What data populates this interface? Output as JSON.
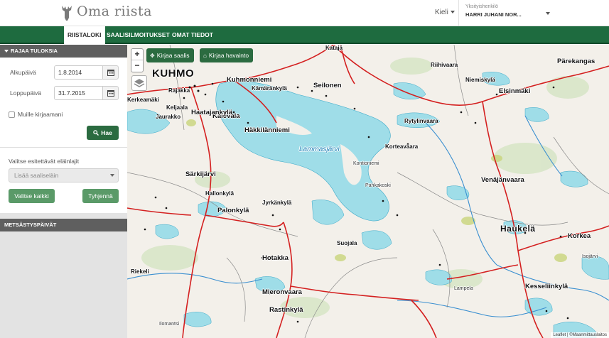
{
  "header": {
    "app_name": "Oma riista",
    "language_label": "Kieli",
    "user_role": "Yksityishenkilö",
    "user_name": "HARRI JUHANI NOR..."
  },
  "nav": {
    "tabs": [
      {
        "label": "RIISTALOKI",
        "active": true
      },
      {
        "label": "SAALISILMOITUKSET",
        "active": false
      },
      {
        "label": "OMAT TIEDOT",
        "active": false
      }
    ]
  },
  "filter_panel": {
    "title": "RAJAA TULOKSIA",
    "start_label": "Alkupäivä",
    "start_value": "1.8.2014",
    "end_label": "Loppupäivä",
    "end_value": "31.7.2015",
    "others_checkbox_label": "Muille kirjaamani",
    "others_checked": false,
    "search_button": "Hae",
    "species_label": "Valitse esitettävät eläinlajit",
    "species_placeholder": "Lisää saaliseläin",
    "select_all_button": "Valitse kaikki",
    "clear_button": "Tyhjennä"
  },
  "hunting_days_panel": {
    "title": "METSÄSTYSPÄIVÄT"
  },
  "map": {
    "zoom_in": "+",
    "zoom_out": "−",
    "add_catch_button": "Kirjaa saalis",
    "add_observation_button": "Kirjaa havainto",
    "attribution": "Leaflet | ©Maanmittauslaitos",
    "places": [
      "KUHMO",
      "Kuhmonniemi",
      "Rajakka",
      "Kerkeamäki",
      "Keljaala",
      "Kalevala",
      "Haatajankylä",
      "Jaurakko",
      "Kämäränkylä",
      "Seilonen",
      "Katajä",
      "Riihivaara",
      "Niemiskylä",
      "Elsinmäki",
      "Pärekangas",
      "Rytylinvaara",
      "Häkkilänniemi",
      "Lammasjärvi",
      "Kontioniemi",
      "Korteavaara",
      "Särkijärvi",
      "Pahkakoski",
      "Hallonkylä",
      "Jyrkänkylä",
      "Palonkylä",
      "Venäjänvaara",
      "Haukelä",
      "Korkea",
      "Hotakka",
      "Riekeli",
      "Mieronvaara",
      "Kesseliinkylä",
      "Rastinkylä",
      "Isojärvi",
      "Lampela",
      "Suojala",
      "Ilomantsi"
    ]
  },
  "colors": {
    "brand_green": "#1e6b3f",
    "button_green": "#5a9a68",
    "panel_header": "#5f5f5f",
    "water": "#9fdde8",
    "road": "#d42020"
  }
}
